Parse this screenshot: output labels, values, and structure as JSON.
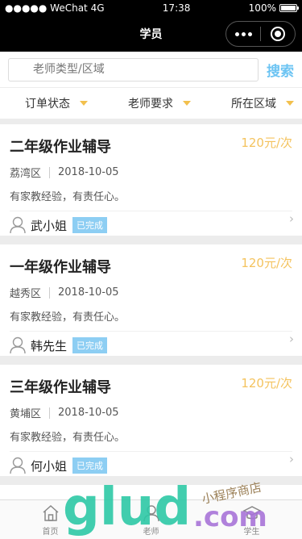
{
  "status_bar": {
    "signal": "●●●●● WeChat 4G",
    "time": "17:38",
    "battery": "100%"
  },
  "nav": {
    "title": "学员"
  },
  "search": {
    "placeholder": "老师类型/区域",
    "button": "搜索"
  },
  "filters": [
    {
      "label": "订单状态"
    },
    {
      "label": "老师要求"
    },
    {
      "label": "所在区域"
    }
  ],
  "cards": [
    {
      "title": "二年级作业辅导",
      "price": "120元/次",
      "district": "荔湾区",
      "date": "2018-10-05",
      "desc": "有家教经验，有责任心。",
      "name": "武小姐",
      "status": "已完成"
    },
    {
      "title": "一年级作业辅导",
      "price": "120元/次",
      "district": "越秀区",
      "date": "2018-10-05",
      "desc": "有家教经验，有责任心。",
      "name": "韩先生",
      "status": "已完成"
    },
    {
      "title": "三年级作业辅导",
      "price": "120元/次",
      "district": "黄埔区",
      "date": "2018-10-05",
      "desc": "有家教经验，有责任心。",
      "name": "何小姐",
      "status": "已完成"
    }
  ],
  "tabbar": [
    {
      "label": "首页",
      "icon": "home-icon"
    },
    {
      "label": "老师",
      "icon": "teacher-icon"
    },
    {
      "label": "学生",
      "icon": "student-icon"
    }
  ],
  "watermark": {
    "text": "glud.com",
    "subtext": "小程序商店"
  },
  "colors": {
    "accent_blue": "#6cc4f3",
    "price_yellow": "#f4c35e",
    "badge_blue": "#8dcef3"
  },
  "chevron": "›"
}
